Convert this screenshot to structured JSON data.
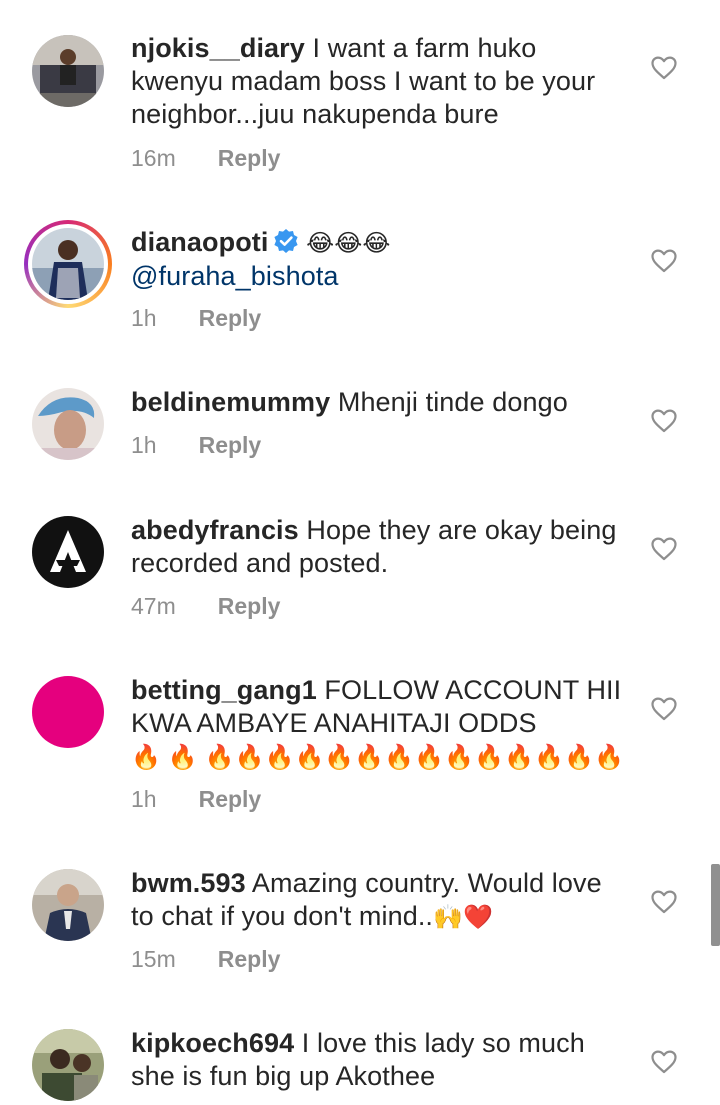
{
  "comments": [
    {
      "username": "njokis__diary",
      "text": " I want a farm huko kwenyu madam boss I want to be your neighbor...juu nakupenda bure",
      "time": "16m",
      "reply": "Reply"
    },
    {
      "username": "dianaopoti",
      "emojis": "😂😂😂",
      "mention": "@furaha_bishota",
      "time": "1h",
      "reply": "Reply"
    },
    {
      "username": "beldinemummy",
      "text": " Mhenji tinde dongo",
      "time": "1h",
      "reply": "Reply"
    },
    {
      "username": "abedyfrancis",
      "text": " Hope they are okay being recorded and posted.",
      "time": "47m",
      "reply": "Reply"
    },
    {
      "username": "betting_gang1",
      "text": " FOLLOW ACCOUNT HII KWA AMBAYE ANAHITAJI ODDS",
      "emojis": "🔥 🔥 🔥🔥🔥🔥🔥🔥🔥🔥🔥🔥🔥🔥🔥🔥",
      "time": "1h",
      "reply": "Reply"
    },
    {
      "username": "bwm.593",
      "text": " Amazing country.  Would love to chat if you don't mind..",
      "emojis": "🙌❤️",
      "time": "15m",
      "reply": "Reply"
    },
    {
      "username": "kipkoech694",
      "text": " I love this lady so much she is fun big up Akothee"
    }
  ],
  "colors": {
    "text": "#262626",
    "meta": "#8e8e8e",
    "mention": "#003569",
    "verified": "#3897f0",
    "heart_outline": "#8e8e8e",
    "avatar_betting_gang1": "#e5007e",
    "avatar_abedyfrancis": "#111111"
  },
  "icons": {
    "like": "heart-outline-icon",
    "verified": "verified-badge-icon"
  }
}
